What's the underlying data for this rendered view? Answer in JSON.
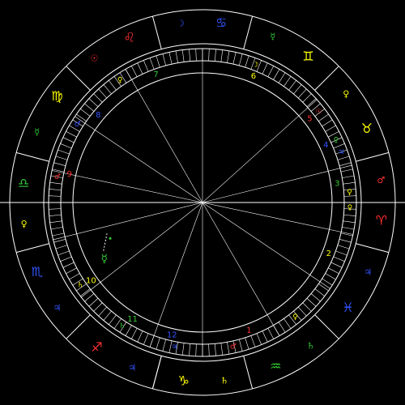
{
  "colors": {
    "background": "#000000",
    "line": "#ffffff",
    "fire": "#ff3030",
    "earth": "#ffff00",
    "air": "#33cc33",
    "water": "#3355ff"
  },
  "zodiac": [
    {
      "sign": "sagittarius",
      "glyph": "♐",
      "color": "#ff3030",
      "ruler": "♃",
      "ruler_color": "#3355ff",
      "mid_angle": 240
    },
    {
      "sign": "scorpio",
      "glyph": "♏",
      "color": "#3355ff",
      "ruler": "♃",
      "ruler_color": "#3355ff",
      "mid_angle": 209
    },
    {
      "sign": "libra",
      "glyph": "♎",
      "color": "#33cc33",
      "ruler": "♀",
      "ruler_color": "#ffff00",
      "mid_angle": 180
    },
    {
      "sign": "virgo",
      "glyph": "♍",
      "color": "#ffff00",
      "ruler": "☿",
      "ruler_color": "#33cc33",
      "mid_angle": 150
    },
    {
      "sign": "leo",
      "glyph": "♌",
      "color": "#ff3030",
      "ruler": "☉",
      "ruler_color": "#ff3030",
      "mid_angle": 120
    },
    {
      "sign": "cancer",
      "glyph": "♋",
      "color": "#3355ff",
      "ruler": "☽",
      "ruler_color": "#3355ff",
      "mid_angle": 90
    },
    {
      "sign": "gemini",
      "glyph": "♊",
      "color": "#ffff00",
      "ruler": "☿",
      "ruler_color": "#33cc33",
      "mid_angle": 60
    },
    {
      "sign": "taurus",
      "glyph": "♉",
      "color": "#ffff00",
      "ruler": "♀",
      "ruler_color": "#ffff00",
      "mid_angle": 30
    },
    {
      "sign": "aries",
      "glyph": "♈",
      "color": "#ff3030",
      "ruler": "♂",
      "ruler_color": "#ff3030",
      "mid_angle": 0
    },
    {
      "sign": "pisces",
      "glyph": "♓",
      "color": "#3355ff",
      "ruler": "♃",
      "ruler_color": "#3355ff",
      "mid_angle": -30
    },
    {
      "sign": "aquarius",
      "glyph": "♒",
      "color": "#33cc33",
      "ruler": "♄",
      "ruler_color": "#33cc33",
      "mid_angle": -60
    },
    {
      "sign": "capricorn",
      "glyph": "♑",
      "color": "#ffff00",
      "ruler": "♄",
      "ruler_color": "#ffff00",
      "mid_angle": -90
    }
  ],
  "sign_boundaries": [
    -105,
    -75,
    -45,
    -15,
    15,
    45,
    75,
    105,
    135,
    165,
    195,
    225,
    255
  ],
  "houses": [
    {
      "number": "1",
      "color": "#ff3030",
      "label_angle": -70
    },
    {
      "number": "2",
      "color": "#ffff00",
      "label_angle": -22
    },
    {
      "number": "3",
      "color": "#33cc33",
      "label_angle": 8
    },
    {
      "number": "4",
      "color": "#3355ff",
      "label_angle": 25
    },
    {
      "number": "5",
      "color": "#ff3030",
      "label_angle": 38
    },
    {
      "number": "6",
      "color": "#ffff00",
      "label_angle": 68
    },
    {
      "number": "7",
      "color": "#33cc33",
      "label_angle": 110
    },
    {
      "number": "8",
      "color": "#3355ff",
      "label_angle": 140
    },
    {
      "number": "9",
      "color": "#ff3030",
      "label_angle": 168
    },
    {
      "number": "10",
      "color": "#ffff00",
      "label_angle": 215
    },
    {
      "number": "11",
      "color": "#33cc33",
      "label_angle": 239
    },
    {
      "number": "12",
      "color": "#3355ff",
      "label_angle": 257
    }
  ],
  "house_cusps": [
    -90,
    -60,
    -34,
    -12,
    14,
    42,
    90,
    120,
    146,
    168,
    194,
    218,
    250
  ],
  "cusp_rulers": [
    {
      "glyph": "♀",
      "color": "#ffff00",
      "angle": -51
    },
    {
      "glyph": "♀",
      "color": "#ffff00",
      "angle": -2
    },
    {
      "glyph": "♀",
      "color": "#ffff00",
      "angle": 4
    },
    {
      "glyph": "♀",
      "color": "#33cc33",
      "angle": 25
    },
    {
      "glyph": "☉",
      "color": "#ff3030",
      "angle": 38
    },
    {
      "glyph": "☽",
      "color": "#ffff00",
      "angle": 69
    },
    {
      "glyph": "♀",
      "color": "#ffff00",
      "angle": 124
    },
    {
      "glyph": "♂",
      "color": "#3355ff",
      "angle": 148
    },
    {
      "glyph": "♂",
      "color": "#ff3030",
      "angle": 170
    },
    {
      "glyph": "♄",
      "color": "#ffff00",
      "angle": 214
    },
    {
      "glyph": "♄",
      "color": "#33cc33",
      "angle": 237
    },
    {
      "glyph": "♃",
      "color": "#3355ff",
      "angle": 259
    },
    {
      "glyph": "♂",
      "color": "#ff3030",
      "angle": -78
    },
    {
      "glyph": "♃",
      "color": "#3355ff",
      "angle": 20
    }
  ],
  "planets": [
    {
      "name": "mercury",
      "glyph": "☿",
      "color": "#33cc33",
      "angle": 210
    }
  ]
}
